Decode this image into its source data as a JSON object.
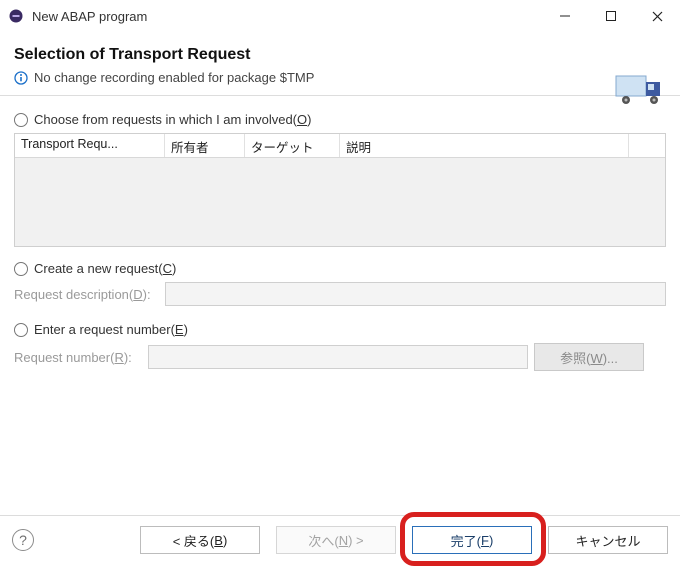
{
  "titlebar": {
    "title": "New ABAP program"
  },
  "header": {
    "heading": "Selection of Transport Request",
    "info": "No change recording enabled for package $TMP"
  },
  "options": {
    "choose_label_pre": "Choose from requests in which I am involved(",
    "choose_mn": "O",
    "choose_label_post": ")",
    "create_label_pre": "Create a new request(",
    "create_mn": "C",
    "create_label_post": ")",
    "enter_label_pre": "Enter a request number(",
    "enter_mn": "E",
    "enter_label_post": ")"
  },
  "table": {
    "col1": "Transport Requ...",
    "col2": "所有者",
    "col3": "ターゲット",
    "col4": "説明"
  },
  "form": {
    "desc_label_pre": "Request description(",
    "desc_mn": "D",
    "desc_label_post": "):",
    "desc_value": "",
    "num_label_pre": "Request number(",
    "num_mn": "R",
    "num_label_post": "):",
    "num_value": "",
    "browse_pre": "参照(",
    "browse_mn": "W",
    "browse_post": ")..."
  },
  "buttons": {
    "back_pre": "< 戻る(",
    "back_mn": "B",
    "back_post": ")",
    "next_pre": "次へ(",
    "next_mn": "N",
    "next_post": ") >",
    "finish_pre": "完了(",
    "finish_mn": "F",
    "finish_post": ")",
    "cancel": "キャンセル"
  }
}
